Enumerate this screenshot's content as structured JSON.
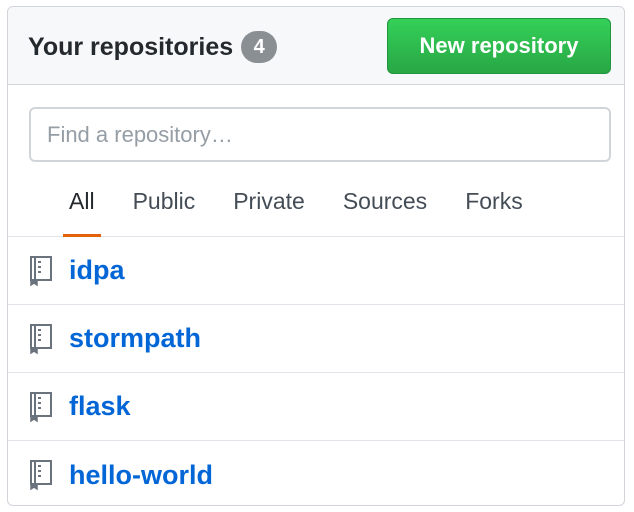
{
  "header": {
    "title": "Your repositories",
    "count": "4",
    "new_button_label": "New repository"
  },
  "search": {
    "placeholder": "Find a repository…",
    "value": ""
  },
  "tabs": [
    {
      "label": "All",
      "selected": true
    },
    {
      "label": "Public",
      "selected": false
    },
    {
      "label": "Private",
      "selected": false
    },
    {
      "label": "Sources",
      "selected": false
    },
    {
      "label": "Forks",
      "selected": false
    }
  ],
  "repositories": [
    {
      "name": "idpa",
      "icon": "repo-icon"
    },
    {
      "name": "stormpath",
      "icon": "repo-icon"
    },
    {
      "name": "flask",
      "icon": "repo-icon"
    },
    {
      "name": "hello-world",
      "icon": "repo-icon"
    }
  ],
  "colors": {
    "accent_green": "#2ea44f",
    "link_blue": "#0366d6",
    "tab_underline": "#e36209",
    "count_badge": "#8a8f94"
  }
}
